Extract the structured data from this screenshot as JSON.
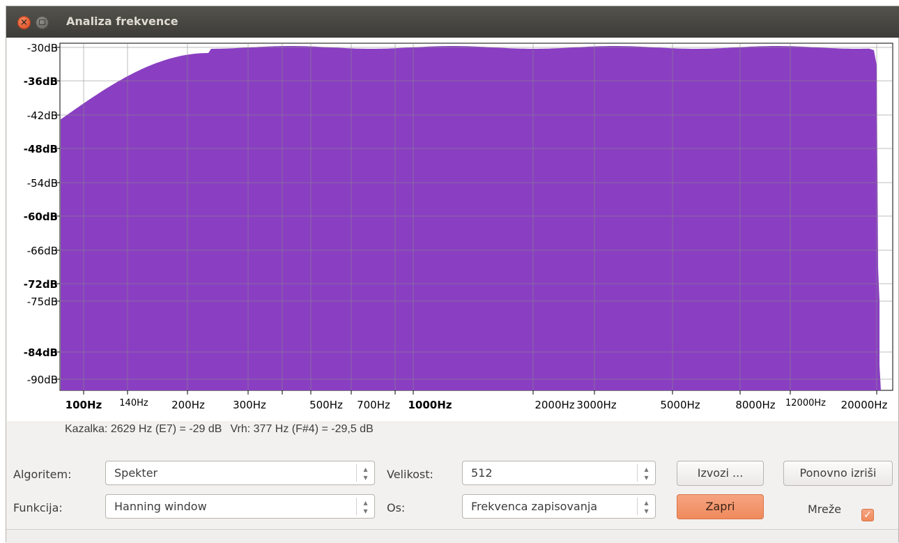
{
  "window": {
    "title": "Analiza frekvence"
  },
  "graph": {
    "y_labels": [
      {
        "text": "-30dB",
        "bold": false
      },
      {
        "text": "-36dB",
        "bold": true
      },
      {
        "text": "-42dB",
        "bold": false
      },
      {
        "text": "-48dB",
        "bold": true
      },
      {
        "text": "-54dB",
        "bold": false
      },
      {
        "text": "-60dB",
        "bold": true
      },
      {
        "text": "-66dB",
        "bold": false
      },
      {
        "text": "-72dB",
        "bold": true
      },
      {
        "text": "-75dB",
        "bold": false
      },
      {
        "text": "-84dB",
        "bold": true
      },
      {
        "text": "-90dB",
        "bold": false
      }
    ],
    "x_labels": [
      {
        "text": "100Hz",
        "bold": true
      },
      {
        "text": "140Hz",
        "bold": false,
        "small": true
      },
      {
        "text": "200Hz",
        "bold": false
      },
      {
        "text": "300Hz",
        "bold": false
      },
      {
        "text": "500Hz",
        "bold": false
      },
      {
        "text": "700Hz",
        "bold": false
      },
      {
        "text": "1000Hz",
        "bold": true
      },
      {
        "text": "2000Hz",
        "bold": false
      },
      {
        "text": "3000Hz",
        "bold": false
      },
      {
        "text": "5000Hz",
        "bold": false
      },
      {
        "text": "8000Hz",
        "bold": false
      },
      {
        "text": "12000Hz",
        "bold": false,
        "small": true
      },
      {
        "text": "20000Hz",
        "bold": false
      }
    ],
    "fill_color": "#8a3fc2"
  },
  "readout": {
    "cursor": "Kazalka: 2629 Hz (E7) = -29 dB",
    "peak": "Vrh: 377 Hz (F#4) = -29,5 dB"
  },
  "controls": {
    "algorithm_label": "Algoritem:",
    "algorithm_value": "Spekter",
    "function_label": "Funkcija:",
    "function_value": "Hanning window",
    "size_label": "Velikost:",
    "size_value": "512",
    "axis_label": "Os:",
    "axis_value": "Frekvenca zapisovanja",
    "export_button": "Izvozi ...",
    "replot_button": "Ponovno izriši",
    "close_button": "Zapri",
    "grids_label": "Mreže",
    "grids_checked": true
  }
}
